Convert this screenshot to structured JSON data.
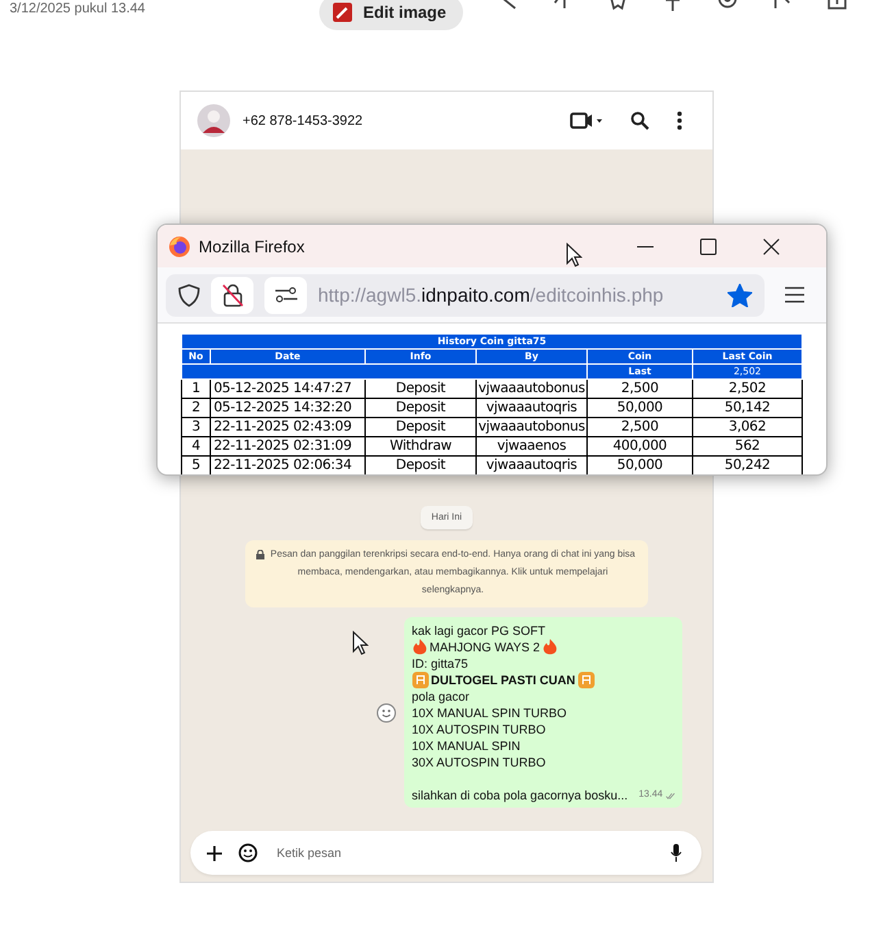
{
  "top_bar": {
    "date": "3/12/2025 pukul 13.44",
    "edit_button": "Edit image"
  },
  "chat": {
    "contact": "+62 878-1453-3922",
    "date_chip": "Hari Ini",
    "notice": "Pesan dan panggilan terenkripsi secara end-to-end. Hanya orang di chat ini yang bisa membaca, mendengarkan, atau membagikannya. Klik untuk mempelajari selengkapnya.",
    "message": {
      "lines": [
        {
          "text": "kak lagi gacor PG SOFT"
        },
        {
          "text": "MAHJONG WAYS 2",
          "kind": "flame"
        },
        {
          "text": "ID:  gitta75"
        },
        {
          "text": "DULTOGEL PASTI CUAN",
          "bold": true,
          "kind": "badge"
        },
        {
          "text": "pola gacor"
        },
        {
          "text": "10X MANUAL SPIN TURBO"
        },
        {
          "text": "10X AUTOSPIN TURBO"
        },
        {
          "text": "10X MANUAL SPIN"
        },
        {
          "text": "30X AUTOSPIN TURBO"
        }
      ],
      "closing": "silahkan di coba pola gacornya bosku...",
      "time": "13.44",
      "read": false
    },
    "input": {
      "placeholder": "Ketik pesan"
    }
  },
  "browser": {
    "title": "Mozilla Firefox",
    "url": {
      "prefix": "http://agwl5.",
      "domain": "idnpaito.com",
      "path": "/editcoinhis.php"
    },
    "bookmarked": true,
    "table": {
      "title": "History Coin gitta75",
      "columns": [
        "No",
        "Date",
        "Info",
        "By",
        "Coin",
        "Last Coin"
      ],
      "summary": {
        "label": "Last",
        "value": "2,502"
      },
      "rows": [
        [
          "1",
          "05-12-2025 14:47:27",
          "Deposit",
          "vjwaaautobonus",
          "2,500",
          "2,502"
        ],
        [
          "2",
          "05-12-2025 14:32:20",
          "Deposit",
          "vjwaaautoqris",
          "50,000",
          "50,142"
        ],
        [
          "3",
          "22-11-2025 02:43:09",
          "Deposit",
          "vjwaaautobonus",
          "2,500",
          "3,062"
        ],
        [
          "4",
          "22-11-2025 02:31:09",
          "Withdraw",
          "vjwaaenos",
          "400,000",
          "562"
        ],
        [
          "5",
          "22-11-2025 02:06:34",
          "Deposit",
          "vjwaaautoqris",
          "50,000",
          "50,242"
        ]
      ]
    }
  }
}
